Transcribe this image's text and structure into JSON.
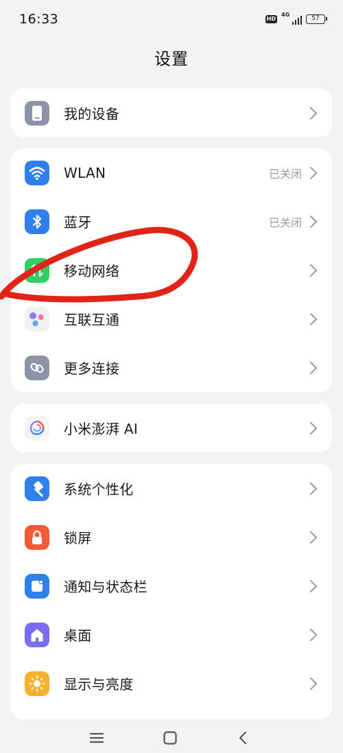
{
  "status_bar": {
    "time": "16:33",
    "hd": "HD",
    "network": "4G",
    "battery": "57"
  },
  "page": {
    "title": "设置"
  },
  "groups": [
    {
      "items": [
        {
          "label": "我的设备",
          "value": "",
          "icon": "phone-icon"
        }
      ]
    },
    {
      "items": [
        {
          "label": "WLAN",
          "value": "已关闭",
          "icon": "wifi-icon"
        },
        {
          "label": "蓝牙",
          "value": "已关闭",
          "icon": "bluetooth-icon"
        },
        {
          "label": "移动网络",
          "value": "",
          "icon": "mobile-data-icon"
        },
        {
          "label": "互联互通",
          "value": "",
          "icon": "interconnect-icon"
        },
        {
          "label": "更多连接",
          "value": "",
          "icon": "link-icon"
        }
      ]
    },
    {
      "items": [
        {
          "label": "小米澎湃 AI",
          "value": "",
          "icon": "hyper-ai-icon"
        }
      ]
    },
    {
      "items": [
        {
          "label": "系统个性化",
          "value": "",
          "icon": "brush-icon"
        },
        {
          "label": "锁屏",
          "value": "",
          "icon": "lock-icon"
        },
        {
          "label": "通知与状态栏",
          "value": "",
          "icon": "notification-icon"
        },
        {
          "label": "桌面",
          "value": "",
          "icon": "home-icon"
        },
        {
          "label": "显示与亮度",
          "value": "",
          "icon": "sun-icon"
        }
      ]
    }
  ],
  "colors": {
    "background": "#f3f3f5",
    "card": "#ffffff",
    "device_icon": "#8e94a8",
    "wifi_icon": "#2f80ed",
    "bluetooth_icon": "#2f80ed",
    "mobile_data_icon": "#2fcf62",
    "link_icon": "#8e94a8",
    "brush_icon": "#2f80ed",
    "lock_icon": "#f25a35",
    "notification_icon": "#2f80ed",
    "home_icon": "#7b6cf0",
    "sun_icon": "#f7b22d",
    "annotation_stroke": "#e02417"
  }
}
